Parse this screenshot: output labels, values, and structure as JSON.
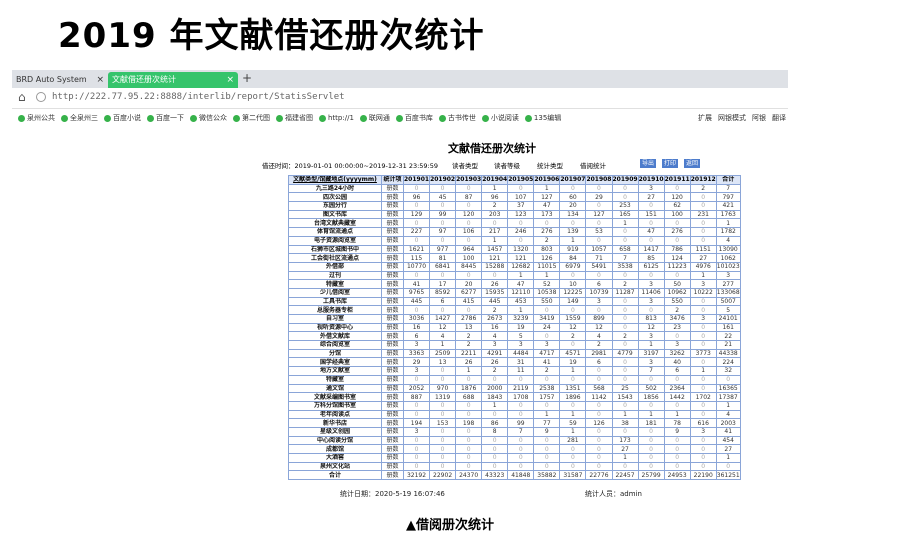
{
  "slide": {
    "title": "2019 年文献借还册次统计",
    "caption": "▲借阅册次统计"
  },
  "browser": {
    "tab1": "BRD Auto System",
    "tab2": "文献借还册次统计",
    "url": "http://222.77.95.22:8888/interlib/report/StatisServlet",
    "bookmarks": [
      "泉州公共",
      "全泉州三",
      "百度小说",
      "百度一下",
      "微信公众",
      "第二代图",
      "福建省图",
      "http://1",
      "联网通",
      "百度书库",
      "古书传世",
      "小说阅读",
      "135编辑"
    ],
    "bookmarks_right": [
      "扩展",
      "网银模式",
      "阿银",
      "翻译"
    ]
  },
  "report": {
    "title": "文献借还册次统计",
    "filter": {
      "time_label": "借还时间：2019-01-01 00:00:00~2019-12-31 23:59:59",
      "type1": "读者类型",
      "type2": "读者等级",
      "type3": "统计类型",
      "type4": "借阅统计",
      "btn1": "导出",
      "btn2": "打印",
      "btn3": "返回"
    },
    "header": [
      "文献类型/馆藏地点(yyyymm)",
      "统计项",
      "201901",
      "201902",
      "201903",
      "201904",
      "201905",
      "201906",
      "201907",
      "201908",
      "201909",
      "201910",
      "201911",
      "201912",
      "合计"
    ],
    "rows": [
      [
        "九三路24小时",
        "册数",
        "0",
        "0",
        "0",
        "1",
        "0",
        "1",
        "0",
        "0",
        "0",
        "3",
        "0",
        "2",
        "7"
      ],
      [
        "四次公园",
        "册数",
        "96",
        "45",
        "87",
        "96",
        "107",
        "127",
        "60",
        "29",
        "0",
        "27",
        "120",
        "0",
        "797"
      ],
      [
        "东园分行",
        "册数",
        "0",
        "0",
        "0",
        "2",
        "37",
        "47",
        "20",
        "0",
        "253",
        "0",
        "62",
        "0",
        "421"
      ],
      [
        "图文书库",
        "册数",
        "129",
        "99",
        "120",
        "203",
        "123",
        "173",
        "134",
        "127",
        "165",
        "151",
        "100",
        "231",
        "1763"
      ],
      [
        "台湾文献典藏室",
        "册数",
        "0",
        "0",
        "0",
        "0",
        "0",
        "0",
        "0",
        "0",
        "1",
        "0",
        "0",
        "0",
        "1"
      ],
      [
        "体育馆流通点",
        "册数",
        "227",
        "97",
        "106",
        "217",
        "246",
        "276",
        "139",
        "53",
        "0",
        "47",
        "276",
        "0",
        "1782"
      ],
      [
        "电子资源阅览室",
        "册数",
        "0",
        "0",
        "0",
        "1",
        "0",
        "2",
        "1",
        "0",
        "0",
        "0",
        "0",
        "0",
        "4"
      ],
      [
        "石狮市区城图书中",
        "册数",
        "1621",
        "977",
        "964",
        "1457",
        "1320",
        "803",
        "919",
        "1057",
        "658",
        "1417",
        "786",
        "1151",
        "13090"
      ],
      [
        "工会街社区流通点",
        "册数",
        "115",
        "81",
        "100",
        "121",
        "121",
        "126",
        "84",
        "71",
        "7",
        "85",
        "124",
        "27",
        "1062"
      ],
      [
        "外借部",
        "册数",
        "10770",
        "6841",
        "8445",
        "15288",
        "12682",
        "11015",
        "6979",
        "5491",
        "3538",
        "6125",
        "11223",
        "4976",
        "101023"
      ],
      [
        "过刊",
        "册数",
        "0",
        "0",
        "0",
        "0",
        "1",
        "1",
        "0",
        "0",
        "0",
        "0",
        "0",
        "1",
        "3"
      ],
      [
        "特藏室",
        "册数",
        "41",
        "17",
        "20",
        "26",
        "47",
        "52",
        "10",
        "6",
        "2",
        "3",
        "50",
        "3",
        "277"
      ],
      [
        "少儿借阅室",
        "册数",
        "9765",
        "8592",
        "6277",
        "15935",
        "12110",
        "10538",
        "12225",
        "10739",
        "11287",
        "11406",
        "10962",
        "10222",
        "133068"
      ],
      [
        "工具书库",
        "册数",
        "445",
        "6",
        "415",
        "445",
        "453",
        "550",
        "149",
        "3",
        "0",
        "3",
        "550",
        "0",
        "5007"
      ],
      [
        "总服务器专柜",
        "册数",
        "0",
        "0",
        "0",
        "2",
        "1",
        "0",
        "0",
        "0",
        "0",
        "0",
        "2",
        "0",
        "5"
      ],
      [
        "自习室",
        "册数",
        "3036",
        "1427",
        "2786",
        "2673",
        "3239",
        "3419",
        "1559",
        "899",
        "0",
        "813",
        "3476",
        "3",
        "24101"
      ],
      [
        "视听资源中心",
        "册数",
        "16",
        "12",
        "13",
        "16",
        "19",
        "24",
        "12",
        "12",
        "0",
        "12",
        "23",
        "0",
        "161"
      ],
      [
        "外借文献库",
        "册数",
        "6",
        "4",
        "2",
        "4",
        "5",
        "0",
        "2",
        "4",
        "2",
        "3",
        "0",
        "0",
        "22"
      ],
      [
        "综合阅览室",
        "册数",
        "3",
        "1",
        "2",
        "3",
        "3",
        "3",
        "0",
        "2",
        "0",
        "1",
        "3",
        "0",
        "21"
      ],
      [
        "分馆",
        "册数",
        "3363",
        "2509",
        "2211",
        "4291",
        "4484",
        "4717",
        "4571",
        "2981",
        "4779",
        "3197",
        "3262",
        "3773",
        "44338"
      ],
      [
        "国学经典室",
        "册数",
        "29",
        "13",
        "26",
        "26",
        "31",
        "41",
        "19",
        "6",
        "0",
        "3",
        "40",
        "0",
        "224"
      ],
      [
        "地方文献室",
        "册数",
        "3",
        "0",
        "1",
        "2",
        "11",
        "2",
        "1",
        "0",
        "0",
        "7",
        "6",
        "1",
        "32"
      ],
      [
        "特藏室",
        "册数",
        "0",
        "0",
        "0",
        "0",
        "0",
        "0",
        "0",
        "0",
        "0",
        "0",
        "0",
        "0",
        "0"
      ],
      [
        "通文馆",
        "册数",
        "2052",
        "970",
        "1876",
        "2000",
        "2119",
        "2538",
        "1351",
        "568",
        "25",
        "502",
        "2364",
        "0",
        "16365"
      ],
      [
        "文献采编图书室",
        "册数",
        "887",
        "1319",
        "688",
        "1843",
        "1708",
        "1757",
        "1896",
        "1142",
        "1543",
        "1856",
        "1442",
        "1702",
        "17387"
      ],
      [
        "万科分馆图书室",
        "册数",
        "0",
        "0",
        "0",
        "1",
        "0",
        "0",
        "0",
        "0",
        "0",
        "0",
        "0",
        "0",
        "1"
      ],
      [
        "老年阅读点",
        "册数",
        "0",
        "0",
        "0",
        "0",
        "0",
        "1",
        "1",
        "0",
        "1",
        "1",
        "1",
        "0",
        "4"
      ],
      [
        "新华书店",
        "册数",
        "194",
        "153",
        "198",
        "86",
        "99",
        "77",
        "59",
        "126",
        "38",
        "181",
        "78",
        "616",
        "2003"
      ],
      [
        "星级文创园",
        "册数",
        "3",
        "0",
        "0",
        "8",
        "7",
        "9",
        "1",
        "0",
        "0",
        "0",
        "9",
        "3",
        "41"
      ],
      [
        "中心阅读分馆",
        "册数",
        "0",
        "0",
        "0",
        "0",
        "0",
        "0",
        "281",
        "0",
        "173",
        "0",
        "0",
        "0",
        "454"
      ],
      [
        "成都馆",
        "册数",
        "0",
        "0",
        "0",
        "0",
        "0",
        "0",
        "0",
        "0",
        "27",
        "0",
        "0",
        "0",
        "27"
      ],
      [
        "大酒窖",
        "册数",
        "0",
        "0",
        "0",
        "0",
        "0",
        "0",
        "0",
        "0",
        "1",
        "0",
        "0",
        "0",
        "1"
      ],
      [
        "泉州文化站",
        "册数",
        "0",
        "0",
        "0",
        "0",
        "0",
        "0",
        "0",
        "0",
        "0",
        "0",
        "0",
        "0",
        "0"
      ],
      [
        "合计",
        "册数",
        "32192",
        "22902",
        "24370",
        "43323",
        "41848",
        "35882",
        "31587",
        "22776",
        "22457",
        "25799",
        "24953",
        "22190",
        "361251"
      ]
    ],
    "footer_left": "统计日期：2020-5-19 16:07:46",
    "footer_right": "统计人员：admin"
  }
}
